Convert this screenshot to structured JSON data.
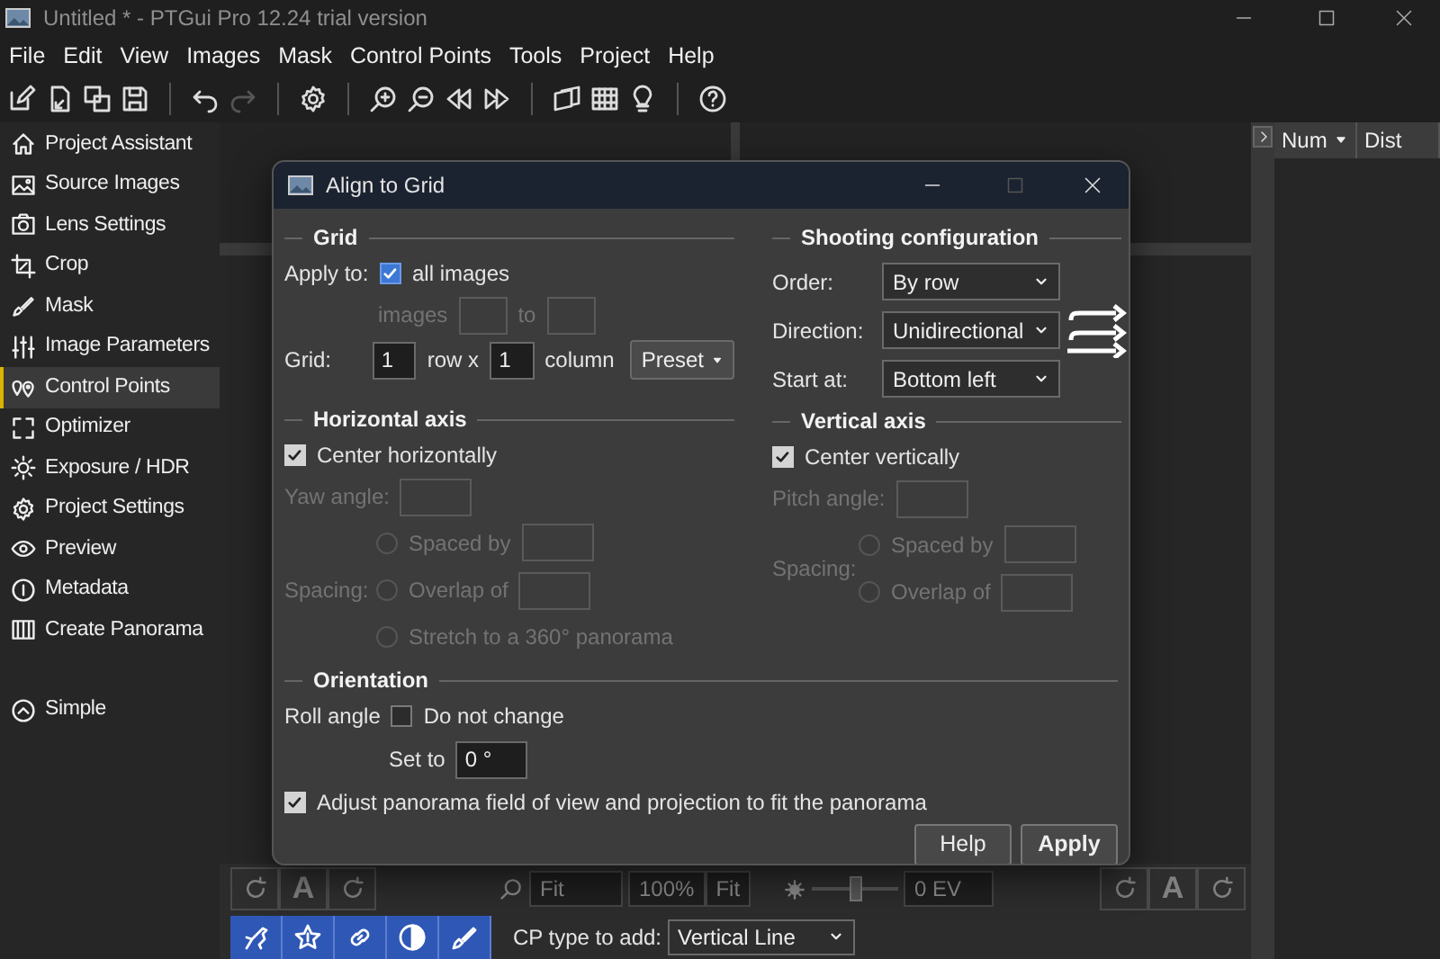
{
  "window": {
    "title": "Untitled * - PTGui Pro 12.24 trial version"
  },
  "menu": [
    "File",
    "Edit",
    "View",
    "Images",
    "Mask",
    "Control Points",
    "Tools",
    "Project",
    "Help"
  ],
  "sidebar": {
    "items": [
      {
        "label": "Project Assistant",
        "selected": false
      },
      {
        "label": "Source Images",
        "selected": false
      },
      {
        "label": "Lens Settings",
        "selected": false
      },
      {
        "label": "Crop",
        "selected": false
      },
      {
        "label": "Mask",
        "selected": false
      },
      {
        "label": "Image Parameters",
        "selected": false
      },
      {
        "label": "Control Points",
        "selected": true
      },
      {
        "label": "Optimizer",
        "selected": false
      },
      {
        "label": "Exposure / HDR",
        "selected": false
      },
      {
        "label": "Project Settings",
        "selected": false
      },
      {
        "label": "Preview",
        "selected": false
      },
      {
        "label": "Metadata",
        "selected": false
      },
      {
        "label": "Create Panorama",
        "selected": false
      }
    ],
    "mode": "Simple"
  },
  "table": {
    "columns": [
      "Num",
      "Dist"
    ]
  },
  "bottom_toolbar": {
    "left_auto": "A",
    "zoom_value": "Fit",
    "zoom_percent": "100%",
    "zoom_fit": "Fit",
    "exposure_slider": {
      "level": 0.5
    },
    "exposure_value": "0 EV",
    "right_auto": "A",
    "cp_type_label": "CP type to add:",
    "cp_type_value": "Vertical Line"
  },
  "dialog": {
    "title": "Align to Grid",
    "grid": {
      "heading": "Grid",
      "apply_label": "Apply to:",
      "all_images": {
        "label": "all images",
        "checked": true,
        "focused": true
      },
      "range": {
        "label": "images",
        "to": "to",
        "disabled": true
      },
      "grid_label": "Grid:",
      "rows": "1",
      "row_label": "row x",
      "columns": "1",
      "column_label": "column",
      "preset": "Preset"
    },
    "shooting": {
      "heading": "Shooting configuration",
      "rows": [
        {
          "label": "Order:",
          "value": "By row"
        },
        {
          "label": "Direction:",
          "value": "Unidirectional"
        },
        {
          "label": "Start at:",
          "value": "Bottom left"
        }
      ]
    },
    "horizontal": {
      "heading": "Horizontal axis",
      "center": {
        "label": "Center horizontally",
        "checked": true
      },
      "angle_label": "Yaw angle:",
      "disabled": true,
      "spacing_label": "Spacing:",
      "options": [
        {
          "label": "Spaced by",
          "kind": "input",
          "selected": false
        },
        {
          "label": "Overlap of",
          "kind": "input",
          "selected": false
        },
        {
          "label": "Stretch to a 360° panorama",
          "kind": "plain",
          "selected": false
        }
      ]
    },
    "vertical": {
      "heading": "Vertical axis",
      "center": {
        "label": "Center vertically",
        "checked": true
      },
      "angle_label": "Pitch angle:",
      "disabled": true,
      "spacing_label": "Spacing:",
      "options": [
        {
          "label": "Spaced by",
          "kind": "input",
          "selected": false
        },
        {
          "label": "Overlap of",
          "kind": "input",
          "selected": false
        }
      ]
    },
    "orientation": {
      "heading": "Orientation",
      "roll_label": "Roll angle",
      "keep": {
        "label": "Do not change",
        "checked": false
      },
      "set_label": "Set to",
      "set_value": "0 °"
    },
    "adjust": {
      "label": "Adjust panorama field of view and projection to fit the panorama",
      "checked": true
    },
    "buttons": [
      {
        "label": "Help",
        "kind": "normal"
      },
      {
        "label": "Apply",
        "kind": "default"
      }
    ]
  }
}
